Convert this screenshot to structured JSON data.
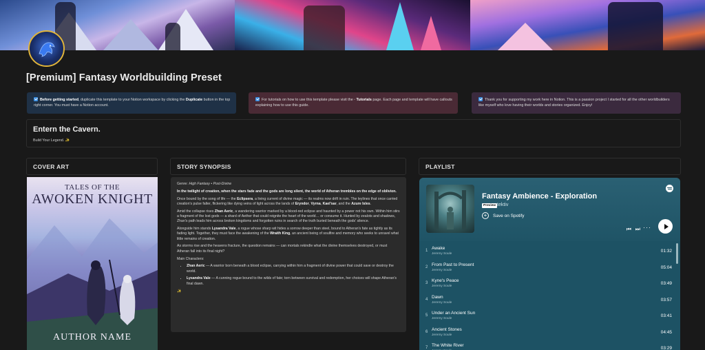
{
  "page": {
    "title": "[Premium] Fantasy Worldbuilding Preset"
  },
  "callouts": [
    {
      "bold_lead": "Before getting started",
      "text_a": ", duplicate this template to your Notion workspace by clicking the ",
      "bold_mid": "Duplicate",
      "text_b": " button in the top right corner. You must have a Notion account."
    },
    {
      "text_a": "For tutorials on how to use this template please visit the ",
      "bold_mid": "Tutorials",
      "text_b": " page. Each page and template will have callouts explaining how to use this guide."
    },
    {
      "text_a": "Thank you for supporting my work here in Notion. This is a passion project I started for all the other worldbuilders like myself who love having their worlds and stories organized. Enjoy!"
    }
  ],
  "entern": {
    "title": "Entern the Cavern.",
    "subtitle": "Build Your Legend. ✨"
  },
  "sections": {
    "cover_art": "COVER ART",
    "synopsis": "STORY SYNOPSIS",
    "playlist": "PLAYLIST"
  },
  "cover": {
    "title_top": "TALES OF THE",
    "title_main": "AWOKEN KNIGHT",
    "author": "AUTHOR NAME"
  },
  "synopsis": {
    "genre_label": "Genre: ",
    "genre_value": "High Fantasy • Post-Divine",
    "intro": "In the twilight of creation, when the stars fade and the gods are long silent, the world of Atheran trembles on the edge of oblivion.",
    "p1_a": "Once bound by the song of life — the ",
    "p1_b": "Eclipsera",
    "p1_c": ", a living current of divine magic — its realms now drift in ruin. The leylines that once carried creation's pulse falter, flickering like dying veins of light across the lands of ",
    "p1_d": "Eryndor",
    "p1_e": ", ",
    "p1_f": "Vyrna",
    "p1_g": ", ",
    "p1_h": "Kael'sar",
    "p1_i": ", and the ",
    "p1_j": "Azure Isles",
    "p1_k": ".",
    "p2_a": "Amid the collapse rises ",
    "p2_b": "Zhan Aeric",
    "p2_c": ", a wandering warrior marked by a blood-red eclipse and haunted by a power not his own. Within him stirs a fragment of the lost gods — a shard of Aether that could reignite the heart of the world… or consume it. Hunted by zealots and shadows, Zhan's path leads him across broken kingdoms and forgotten ruins in search of the truth buried beneath the gods' silence.",
    "p3_a": "Alongside him stands ",
    "p3_b": "Lysandra Vale",
    "p3_c": ", a rogue whose sharp wit hides a sorrow deeper than steel, bound to Atheran's fate as tightly as its fading light. Together, they must face the awakening of the ",
    "p3_d": "Wraith King",
    "p3_e": ", an ancient being of soulfire and memory who seeks to unravel what little remains of creation.",
    "p4": "As storms rise and the heavens fracture, the question remains — can mortals rekindle what the divine themselves destroyed, or must Atheran fall into its final night?",
    "main_chars_label": "Main Characters:",
    "char1_name": "Zhan Aeric",
    "char1_desc": " — A warrior born beneath a blood eclipse, carrying within him a fragment of divine power that could save or destroy the world.",
    "char2_name": "Lysandra Vale",
    "char2_desc": " — A cunning rogue bound to the wilds of fate; torn between survival and redemption, her choices will shape Atheran's final dawn.",
    "sparkle": "✨"
  },
  "player": {
    "title": "Fantasy Ambience - Exploration",
    "preview_badge": "Preview",
    "artist": "tektiv",
    "save_label": "Save on Spotify",
    "more_glyph": "···",
    "tracks": [
      {
        "num": "1",
        "title": "Awake",
        "artist": "Jeremy Soule",
        "duration": "01:32"
      },
      {
        "num": "2",
        "title": "From Past to Present",
        "artist": "Jeremy Soule",
        "duration": "05:04"
      },
      {
        "num": "3",
        "title": "Kyne's Peace",
        "artist": "Jeremy Soule",
        "duration": "03:49"
      },
      {
        "num": "4",
        "title": "Dawn",
        "artist": "Jeremy Soule",
        "duration": "03:57"
      },
      {
        "num": "5",
        "title": "Under an Ancient Sun",
        "artist": "Jeremy Soule",
        "duration": "03:41"
      },
      {
        "num": "6",
        "title": "Ancient Stones",
        "artist": "Jeremy Soule",
        "duration": "04:45"
      },
      {
        "num": "7",
        "title": "The White River",
        "artist": "Jeremy Soule",
        "duration": "03:29"
      }
    ]
  },
  "icons": {
    "callout_check": "check-icon",
    "tutorials_link": "page-icon",
    "spotify": "spotify-icon",
    "avatar": "dragon-icon"
  }
}
